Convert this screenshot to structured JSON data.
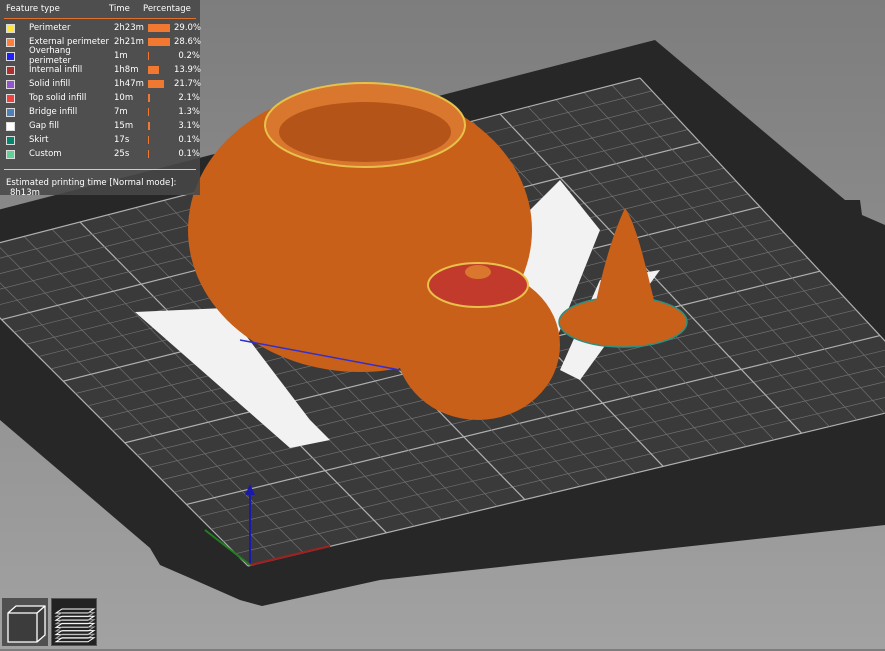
{
  "legend": {
    "headers": {
      "feature": "Feature type",
      "time": "Time",
      "percentage": "Percentage"
    },
    "items": [
      {
        "label": "Perimeter",
        "time": "2h23m",
        "percent": "29.0%",
        "value": 29.0,
        "color": "#ffe53b"
      },
      {
        "label": "External perimeter",
        "time": "2h21m",
        "percent": "28.6%",
        "value": 28.6,
        "color": "#ff7d38"
      },
      {
        "label": "Overhang perimeter",
        "time": "1m",
        "percent": "0.2%",
        "value": 0.2,
        "color": "#1f1fff"
      },
      {
        "label": "Internal infill",
        "time": "1h8m",
        "percent": "13.9%",
        "value": 13.9,
        "color": "#b03029"
      },
      {
        "label": "Solid infill",
        "time": "1h47m",
        "percent": "21.7%",
        "value": 21.7,
        "color": "#9654cc"
      },
      {
        "label": "Top solid infill",
        "time": "10m",
        "percent": "2.1%",
        "value": 2.1,
        "color": "#f04040"
      },
      {
        "label": "Bridge infill",
        "time": "7m",
        "percent": "1.3%",
        "value": 1.3,
        "color": "#4d80ba"
      },
      {
        "label": "Gap fill",
        "time": "15m",
        "percent": "3.1%",
        "value": 3.1,
        "color": "#ffffff"
      },
      {
        "label": "Skirt",
        "time": "17s",
        "percent": "0.1%",
        "value": 0.1,
        "color": "#00876e"
      },
      {
        "label": "Custom",
        "time": "25s",
        "percent": "0.1%",
        "value": 0.1,
        "color": "#5ed194"
      }
    ],
    "estimate_label": "Estimated printing time [Normal mode]:",
    "estimate_value": "8h13m"
  },
  "view_buttons": [
    {
      "name": "3d-view"
    },
    {
      "name": "preview"
    }
  ],
  "colors": {
    "model": "#d4681e",
    "bed": "#2a2a2a",
    "grid": "#8a8a8a"
  }
}
